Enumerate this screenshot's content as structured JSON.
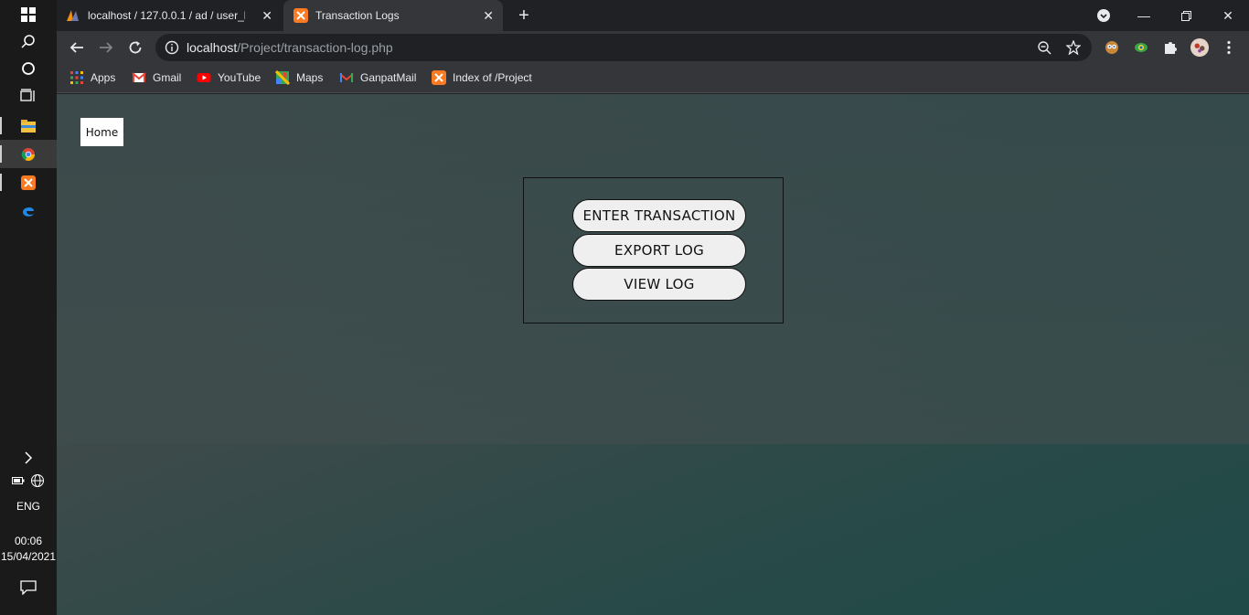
{
  "taskbar": {
    "time": "00:06",
    "date": "15/04/2021",
    "language": "ENG"
  },
  "browser": {
    "tabs": [
      {
        "title": "localhost / 127.0.0.1 / ad / user_l",
        "active": false
      },
      {
        "title": "Transaction Logs",
        "active": true
      }
    ],
    "url_host": "localhost",
    "url_path": "/Project/transaction-log.php",
    "bookmarks": [
      {
        "label": "Apps",
        "icon": "apps-grid-icon"
      },
      {
        "label": "Gmail",
        "icon": "gmail-icon"
      },
      {
        "label": "YouTube",
        "icon": "youtube-icon"
      },
      {
        "label": "Maps",
        "icon": "maps-icon"
      },
      {
        "label": "GanpatMail",
        "icon": "gmail-icon"
      },
      {
        "label": "Index of /Project",
        "icon": "xampp-icon"
      }
    ]
  },
  "page": {
    "home_link": "Home",
    "buttons": {
      "enter": "ENTER TRANSACTION",
      "export": "EXPORT LOG",
      "view": "VIEW LOG"
    }
  },
  "colors": {
    "accent_tab": "#35363a",
    "page_bg": "#2d4a4a",
    "button_bg": "#efefef"
  }
}
